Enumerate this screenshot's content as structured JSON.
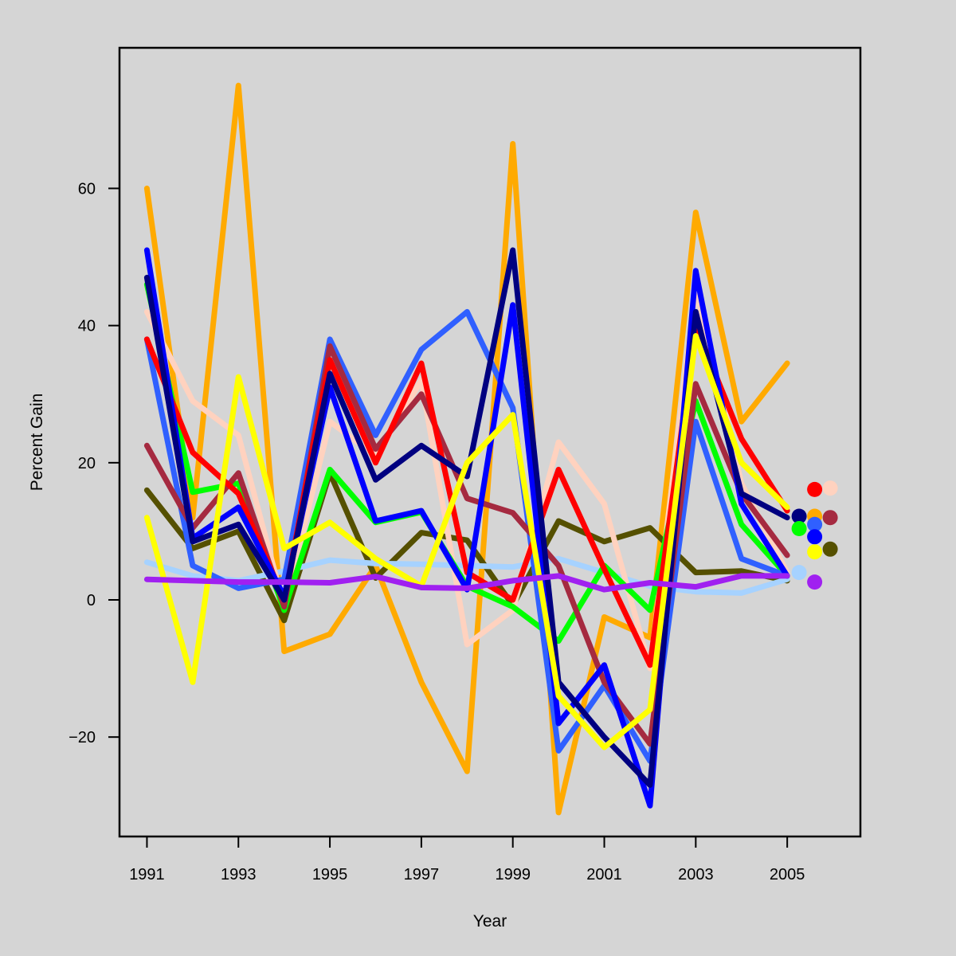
{
  "chart_data": {
    "type": "line",
    "title": "",
    "xlabel": "Year",
    "ylabel": "Percent Gain",
    "xlim": [
      1990.4,
      2006.6
    ],
    "ylim": [
      -34.5,
      80.5
    ],
    "grid": false,
    "legend": "none",
    "background": "#d5d5d5",
    "x_ticks": [
      1991,
      1993,
      1995,
      1997,
      1999,
      2001,
      2003,
      2005
    ],
    "x_tick_labels": [
      "1991",
      "1993",
      "1995",
      "1997",
      "1999",
      "2001",
      "2003",
      "2005"
    ],
    "y_ticks": [
      -20,
      0,
      20,
      40,
      60
    ],
    "y_tick_labels": [
      "−20",
      "0",
      "20",
      "40",
      "60"
    ],
    "x": [
      1991,
      1992,
      1993,
      1994,
      1995,
      1996,
      1997,
      1998,
      1999,
      2000,
      2001,
      2002,
      2003,
      2004,
      2005
    ],
    "series": [
      {
        "name": "orange",
        "color": "#ffaa00",
        "values": [
          60,
          12,
          75,
          -7.5,
          -5,
          5,
          -12,
          -25,
          66.5,
          -31,
          -2.5,
          -5.5,
          56.5,
          26,
          34.5
        ]
      },
      {
        "name": "olive",
        "color": "#555000",
        "values": [
          16,
          7.5,
          10,
          -3,
          18.5,
          3.2,
          9.8,
          8.7,
          -0.8,
          11.5,
          8.5,
          10.5,
          4,
          4.2,
          2.8
        ]
      },
      {
        "name": "light-blue",
        "color": "#a6d2ff",
        "values": [
          5.5,
          3.5,
          2.8,
          4.2,
          5.8,
          5.3,
          5.2,
          5,
          4.8,
          6,
          4,
          2,
          1.2,
          1,
          3
        ]
      },
      {
        "name": "peach",
        "color": "#ffd2bf",
        "values": [
          42,
          29,
          24,
          -1,
          26,
          21,
          32,
          -6.5,
          -1.5,
          23,
          14,
          -10,
          45.5,
          17,
          4
        ]
      },
      {
        "name": "green",
        "color": "#00ff00",
        "values": [
          46,
          15.7,
          17,
          -1.5,
          19,
          11.3,
          12.8,
          2,
          -1,
          -6,
          5,
          -1.5,
          29,
          11,
          3.5
        ]
      },
      {
        "name": "royal-blue",
        "color": "#3060ff",
        "values": [
          38,
          5,
          1.7,
          3,
          38,
          24,
          36.5,
          42,
          28,
          -22,
          -12.5,
          -23.5,
          26,
          6,
          3.5
        ]
      },
      {
        "name": "brown",
        "color": "#a52a40",
        "values": [
          22.5,
          10.5,
          18.5,
          -1,
          37,
          22,
          30,
          14.8,
          12.7,
          5,
          -12,
          -21,
          31.5,
          15.5,
          6.5
        ]
      },
      {
        "name": "red",
        "color": "#ff0000",
        "values": [
          38,
          21.5,
          15.5,
          0,
          35,
          20,
          34.5,
          4,
          0,
          19,
          4.5,
          -9.5,
          40,
          23.5,
          13
        ]
      },
      {
        "name": "blue",
        "color": "#0000ff",
        "values": [
          51,
          9,
          13.5,
          0.5,
          31,
          11.5,
          13,
          1.5,
          43,
          -18,
          -9.5,
          -30,
          48,
          14,
          3.5
        ]
      },
      {
        "name": "navy",
        "color": "#000080",
        "values": [
          47,
          8.5,
          11,
          0,
          33,
          17.5,
          22.5,
          18,
          51,
          -12,
          -20,
          -27,
          42,
          15.5,
          12
        ]
      },
      {
        "name": "yellow",
        "color": "#ffff00",
        "values": [
          12,
          -12,
          32.5,
          7.5,
          11.3,
          6,
          2,
          20,
          27,
          -14,
          -21.5,
          -16,
          38.5,
          20,
          13.5
        ]
      },
      {
        "name": "purple",
        "color": "#a020f0",
        "values": [
          3,
          2.8,
          2.6,
          2.6,
          2.5,
          3.4,
          1.8,
          1.7,
          2.8,
          3.5,
          1.5,
          2.5,
          1.9,
          3.5,
          3.5
        ]
      }
    ],
    "markers": [
      {
        "name": "red",
        "color": "#ff0000",
        "x": 2005.6,
        "y": 16.1
      },
      {
        "name": "peach",
        "color": "#ffd2bf",
        "x": 2005.94,
        "y": 16.3
      },
      {
        "name": "navy",
        "color": "#000080",
        "x": 2005.26,
        "y": 12.2
      },
      {
        "name": "orange",
        "color": "#ffaa00",
        "x": 2005.6,
        "y": 12.2
      },
      {
        "name": "brown",
        "color": "#a52a40",
        "x": 2005.94,
        "y": 12.0
      },
      {
        "name": "royal-blue",
        "color": "#3060ff",
        "x": 2005.6,
        "y": 11.0
      },
      {
        "name": "green",
        "color": "#00ff00",
        "x": 2005.26,
        "y": 10.4
      },
      {
        "name": "blue",
        "color": "#0000ff",
        "x": 2005.6,
        "y": 9.2
      },
      {
        "name": "yellow",
        "color": "#ffff00",
        "x": 2005.6,
        "y": 7.0
      },
      {
        "name": "olive",
        "color": "#555000",
        "x": 2005.94,
        "y": 7.4
      },
      {
        "name": "light-blue",
        "color": "#a6d2ff",
        "x": 2005.26,
        "y": 4.0
      },
      {
        "name": "purple",
        "color": "#a020f0",
        "x": 2005.6,
        "y": 2.6
      }
    ]
  }
}
